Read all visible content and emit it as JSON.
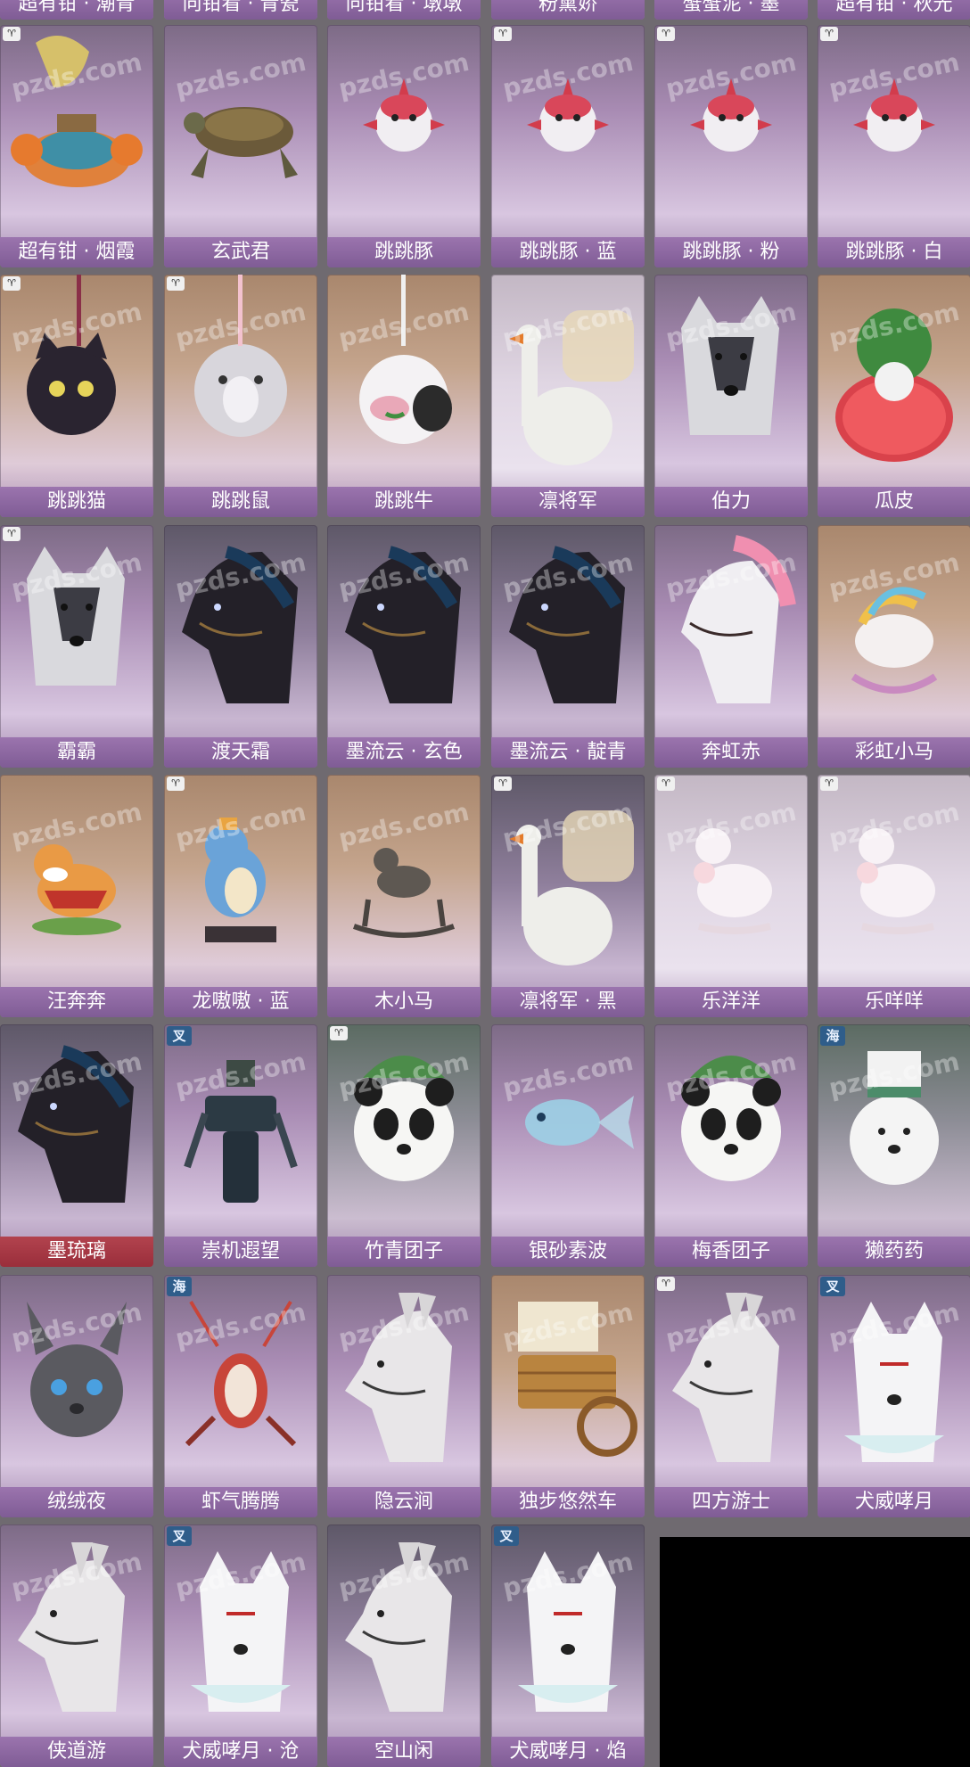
{
  "watermark": "pzds.com",
  "top_row": [
    "超有钳 · 潮青",
    "向钳看 · 青瓷",
    "向钳看 · 墩墩",
    "粉黛娇",
    "蟹蟹泥 · 墨",
    "超有钳 · 秋光"
  ],
  "cards": [
    {
      "name": "超有钳 · 烟霞",
      "icon": "crab-icon",
      "badge": "♈",
      "bg": "default"
    },
    {
      "name": "玄武君",
      "icon": "turtle-icon",
      "badge": "",
      "bg": "default"
    },
    {
      "name": "跳跳豚",
      "icon": "pufferfish-icon",
      "badge": "",
      "bg": "default"
    },
    {
      "name": "跳跳豚 · 蓝",
      "icon": "pufferfish-icon",
      "badge": "♈",
      "bg": "default"
    },
    {
      "name": "跳跳豚 · 粉",
      "icon": "pufferfish-icon",
      "badge": "♈",
      "bg": "default"
    },
    {
      "name": "跳跳豚 · 白",
      "icon": "pufferfish-icon",
      "badge": "♈",
      "bg": "default"
    },
    {
      "name": "跳跳猫",
      "icon": "cat-icon",
      "badge": "♈",
      "bg": "orange"
    },
    {
      "name": "跳跳鼠",
      "icon": "hamster-icon",
      "badge": "♈",
      "bg": "orange"
    },
    {
      "name": "跳跳牛",
      "icon": "cow-icon",
      "badge": "",
      "bg": "orange"
    },
    {
      "name": "凛将军",
      "icon": "goose-icon",
      "badge": "",
      "bg": "pale"
    },
    {
      "name": "伯力",
      "icon": "husky-icon",
      "badge": "",
      "bg": "default"
    },
    {
      "name": "瓜皮",
      "icon": "watermelon-icon",
      "badge": "",
      "bg": "orange"
    },
    {
      "name": "霸霸",
      "icon": "husky-icon",
      "badge": "♈",
      "bg": "default"
    },
    {
      "name": "渡天霜",
      "icon": "horse-icon",
      "badge": "",
      "bg": "dark"
    },
    {
      "name": "墨流云 · 玄色",
      "icon": "horse-icon",
      "badge": "",
      "bg": "dark"
    },
    {
      "name": "墨流云 · 靛青",
      "icon": "horse-icon",
      "badge": "",
      "bg": "dark"
    },
    {
      "name": "奔虹赤",
      "icon": "pony-icon",
      "badge": "",
      "bg": "default"
    },
    {
      "name": "彩虹小马",
      "icon": "rocking-pony-icon",
      "badge": "",
      "bg": "orange"
    },
    {
      "name": "汪奔奔",
      "icon": "corgi-icon",
      "badge": "",
      "bg": "orange"
    },
    {
      "name": "龙嗷嗷 · 蓝",
      "icon": "dino-icon",
      "badge": "♈",
      "bg": "orange"
    },
    {
      "name": "木小马",
      "icon": "rocking-horse-icon",
      "badge": "",
      "bg": "orange"
    },
    {
      "name": "凛将军 · 黑",
      "icon": "goose-icon",
      "badge": "♈",
      "bg": "dark"
    },
    {
      "name": "乐洋洋",
      "icon": "sheep-icon",
      "badge": "♈",
      "bg": "pale"
    },
    {
      "name": "乐咩咩",
      "icon": "sheep-icon",
      "badge": "♈",
      "bg": "pale"
    },
    {
      "name": "墨琉璃",
      "icon": "horse-icon",
      "badge": "",
      "bg": "dark",
      "red": true
    },
    {
      "name": "崇机遐望",
      "icon": "mech-icon",
      "badge": "叉",
      "bg": "default"
    },
    {
      "name": "竹青团子",
      "icon": "panda-icon",
      "badge": "♈",
      "bg": "teal"
    },
    {
      "name": "银砂素波",
      "icon": "fish-icon",
      "badge": "",
      "bg": "default"
    },
    {
      "name": "梅香团子",
      "icon": "panda-icon",
      "badge": "",
      "bg": "default"
    },
    {
      "name": "獭药药",
      "icon": "bear-icon",
      "badge": "海",
      "bg": "teal"
    },
    {
      "name": "绒绒夜",
      "icon": "rabbit-icon",
      "badge": "",
      "bg": "default"
    },
    {
      "name": "虾气腾腾",
      "icon": "shrimp-icon",
      "badge": "海",
      "bg": "default"
    },
    {
      "name": "隐云涧",
      "icon": "donkey-icon",
      "badge": "",
      "bg": "default"
    },
    {
      "name": "独步悠然车",
      "icon": "cart-icon",
      "badge": "",
      "bg": "orange"
    },
    {
      "name": "四方游士",
      "icon": "donkey-icon",
      "badge": "♈",
      "bg": "default"
    },
    {
      "name": "犬威哮月",
      "icon": "wolf-icon",
      "badge": "叉",
      "bg": "default"
    },
    {
      "name": "侠道游",
      "icon": "donkey-icon",
      "badge": "",
      "bg": "default"
    },
    {
      "name": "犬威哮月 · 沧",
      "icon": "wolf-icon",
      "badge": "叉",
      "bg": "default"
    },
    {
      "name": "空山闲",
      "icon": "donkey-icon",
      "badge": "",
      "bg": "dark"
    },
    {
      "name": "犬威哮月 · 焰",
      "icon": "wolf-icon",
      "badge": "叉",
      "bg": "dark"
    }
  ]
}
